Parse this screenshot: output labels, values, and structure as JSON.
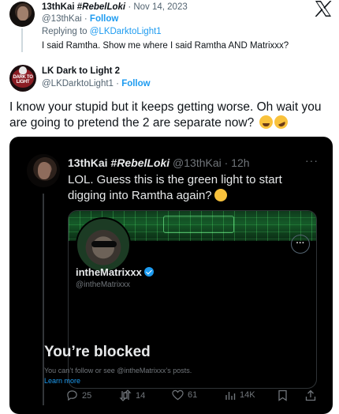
{
  "reply": {
    "name_prefix": "13thKai #",
    "name_tag": "RebelLoki",
    "date": "· Nov 14, 2023",
    "handle": "@13thKai",
    "follow_label": "Follow",
    "replying_prefix": "Replying to",
    "replying_handle": "@LKDarktoLight1",
    "text": "I said Ramtha.  Show me where I said Ramtha AND Matrixxx?"
  },
  "main": {
    "name": "LK Dark to Light 2",
    "handle": "@LKDarktoLight1",
    "follow_label": "Follow",
    "text": "I know your stupid but it keeps getting worse. Oh wait you are going to pretend the 2 are separate now?",
    "emojis": [
      "tears-of-joy-emoji",
      "rolling-laughing-emoji"
    ]
  },
  "screenshot": {
    "name_prefix": "13thKai #",
    "name_tag": "RebelLoki",
    "handle_time": "@13thKai · 12h",
    "more_label": "···",
    "text": "LOL. Guess this is the green light to start digging into Ramtha again?",
    "emoji": "thinking-face-emoji",
    "profile": {
      "more_label": "···",
      "name": "intheMatrixxx",
      "handle": "@intheMatrixxx",
      "blocked_title": "You’re blocked",
      "blocked_sub": "You can’t follow or see @intheMatrixxx’s posts.",
      "learn_more": "Learn more"
    },
    "actions": {
      "replies": "25",
      "reposts": "14",
      "likes": "61",
      "views": "14K"
    }
  },
  "colors": {
    "accent": "#1d9bf0",
    "text": "#0f1419",
    "muted": "#536471",
    "dark_bg": "#000000",
    "dark_text": "#e7e9ea"
  }
}
